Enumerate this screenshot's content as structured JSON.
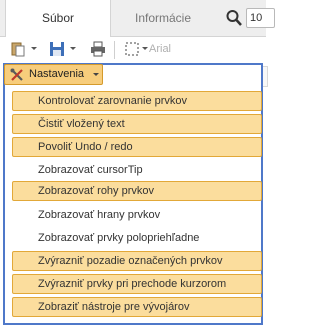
{
  "tabs": [
    {
      "label": "Súbor",
      "active": true
    },
    {
      "label": "Informácie",
      "active": false
    }
  ],
  "page_input_value": "10",
  "toolbar": {
    "font_name": "Arial"
  },
  "menu_button": {
    "label": "Nastavenia"
  },
  "menu": {
    "items": [
      {
        "label": "Kontrolovať zarovnanie prvkov",
        "checked": true
      },
      {
        "label": "Čistiť vložený text",
        "checked": true
      },
      {
        "label": "Povoliť Undo / redo",
        "checked": true
      },
      {
        "label": "Zobrazovať cursorTip",
        "checked": false
      },
      {
        "label": "Zobrazovať rohy prvkov",
        "checked": true
      },
      {
        "label": "Zobrazovať hrany prvkov",
        "checked": false
      },
      {
        "label": "Zobrazovať prvky polopriehľadne",
        "checked": false
      },
      {
        "label": "Zvýrazniť pozadie označených prvkov",
        "checked": true
      },
      {
        "label": "Zvýrazniť prvky pri prechode kurzorom",
        "checked": true
      },
      {
        "label": "Zobraziť nástroje pre vývojárov",
        "checked": true
      }
    ]
  },
  "colors": {
    "checked_bg": "#fbdd9d",
    "checked_border": "#e2a838",
    "menu_border": "#4f78c9"
  }
}
